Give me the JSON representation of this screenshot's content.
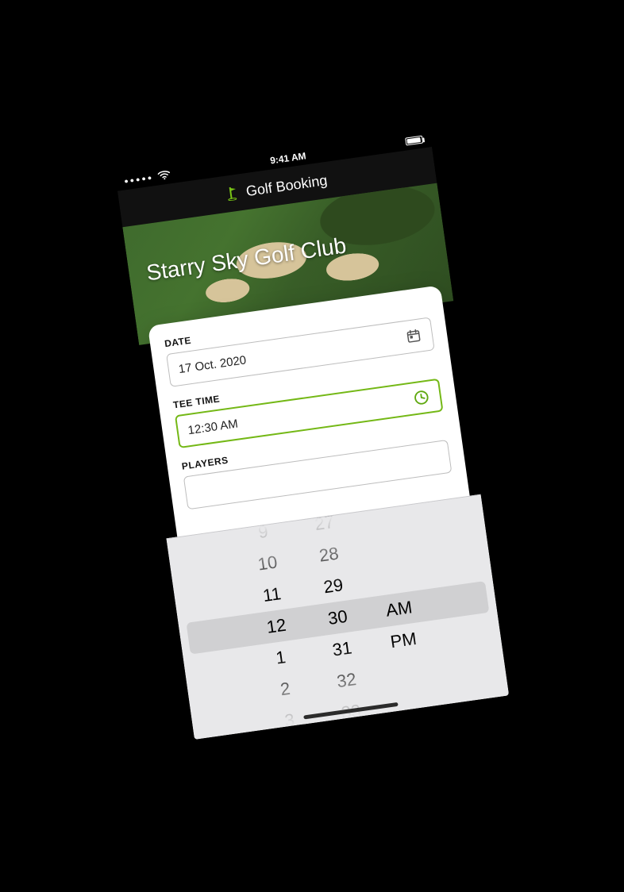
{
  "status_bar": {
    "time": "9:41 AM"
  },
  "nav": {
    "title": "Golf Booking"
  },
  "hero": {
    "club_name": "Starry Sky Golf Club"
  },
  "form": {
    "date_label": "DATE",
    "date_value": "17 Oct. 2020",
    "tee_time_label": "TEE TIME",
    "tee_time_value": "12:30 AM",
    "players_label": "PLAYERS"
  },
  "time_picker": {
    "hours": [
      "9",
      "10",
      "11",
      "12",
      "1",
      "2",
      "3"
    ],
    "minutes": [
      "27",
      "28",
      "29",
      "30",
      "31",
      "32",
      "33"
    ],
    "periods": [
      "AM",
      "PM"
    ],
    "selected": {
      "hour": "12",
      "minute": "30",
      "period": "AM"
    }
  }
}
